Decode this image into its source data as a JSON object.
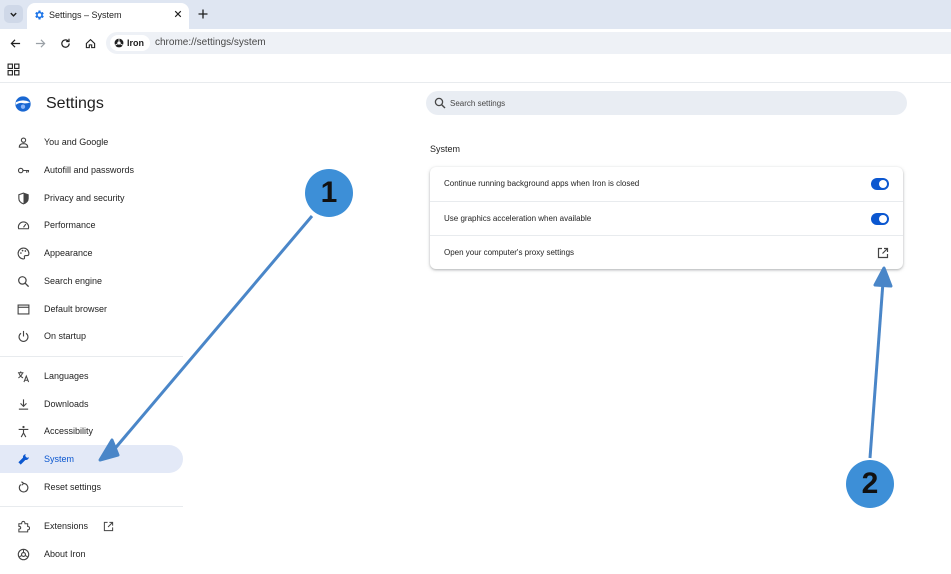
{
  "browser": {
    "tab": {
      "title": "Settings – System",
      "favicon": "gear-icon"
    },
    "omnibox": {
      "chip_label": "Iron",
      "url": "chrome://settings/system"
    }
  },
  "settings": {
    "title": "Settings",
    "search_placeholder": "Search settings"
  },
  "sidebar": {
    "items": [
      {
        "label": "You and Google",
        "icon": "person-icon"
      },
      {
        "label": "Autofill and passwords",
        "icon": "key-icon"
      },
      {
        "label": "Privacy and security",
        "icon": "shield-icon"
      },
      {
        "label": "Performance",
        "icon": "speedometer-icon"
      },
      {
        "label": "Appearance",
        "icon": "palette-icon"
      },
      {
        "label": "Search engine",
        "icon": "search-icon"
      },
      {
        "label": "Default browser",
        "icon": "browser-window-icon"
      },
      {
        "label": "On startup",
        "icon": "power-icon"
      },
      {
        "label": "Languages",
        "icon": "translate-icon"
      },
      {
        "label": "Downloads",
        "icon": "download-icon"
      },
      {
        "label": "Accessibility",
        "icon": "accessibility-icon"
      },
      {
        "label": "System",
        "icon": "wrench-icon",
        "selected": true
      },
      {
        "label": "Reset settings",
        "icon": "reset-icon"
      },
      {
        "label": "Extensions",
        "icon": "puzzle-icon"
      },
      {
        "label": "About Iron",
        "icon": "iron-logo-icon"
      }
    ]
  },
  "main": {
    "section_title": "System",
    "rows": [
      {
        "label": "Continue running background apps when Iron is closed",
        "control": "toggle",
        "checked": true
      },
      {
        "label": "Use graphics acceleration when available",
        "control": "toggle",
        "checked": true
      },
      {
        "label": "Open your computer's proxy settings",
        "control": "external-link"
      }
    ]
  },
  "annotations": {
    "callout_1": "1",
    "callout_2": "2",
    "color": "#3d8fd7",
    "arrow_color": "#4a86c8"
  },
  "colors": {
    "accent": "#0b57d0",
    "selected_bg": "#e3e9f7",
    "tabstrip_bg": "#dfe6f2"
  }
}
